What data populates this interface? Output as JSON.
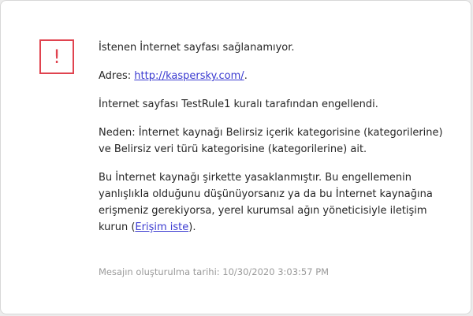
{
  "message": {
    "title": "İstenen İnternet sayfası sağlanamıyor.",
    "address_label": "Adres: ",
    "address_url": "http://kaspersky.com/",
    "address_suffix": ".",
    "blocked_text": "İnternet sayfası TestRule1 kuralı tarafından engellendi.",
    "reason_text": "Neden: İnternet kaynağı Belirsiz içerik kategorisine (kategorilerine) ve Belirsiz veri türü kategorisine (kategorilerine) ait.",
    "policy_text": "Bu İnternet kaynağı şirkette yasaklanmıştır. Bu engellemenin yanlışlıkla olduğunu düşünüyorsanız ya da bu İnternet kaynağına erişmeniz gerekiyorsa, yerel kurumsal ağın yöneticisiyle iletişim kurun (",
    "request_access_link": "Erişim iste",
    "policy_suffix": ").",
    "timestamp": "Mesajın oluşturulma tarihi: 10/30/2020 3:03:57 PM"
  },
  "icon": {
    "name": "alert-icon",
    "glyph": "!",
    "color": "#e0434f"
  },
  "colors": {
    "link": "#3a3ad0",
    "text": "#262626",
    "muted": "#9a9a9a"
  }
}
